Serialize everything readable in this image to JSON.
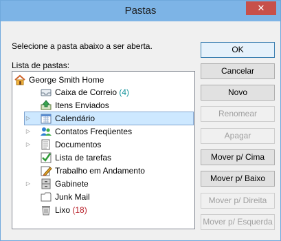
{
  "window": {
    "title": "Pastas",
    "close_glyph": "✕"
  },
  "prompt": "Selecione a pasta abaixo a ser aberta.",
  "list_label": "Lista de pastas:",
  "tree": {
    "root": {
      "label": "George Smith Home",
      "icon": "home-icon"
    },
    "items": [
      {
        "label": "Caixa de Correio",
        "count": "(4)",
        "icon": "inbox-icon",
        "expandable": false
      },
      {
        "label": "Itens Enviados",
        "count": "",
        "icon": "sent-items-icon",
        "expandable": false
      },
      {
        "label": "Calendário",
        "count": "",
        "icon": "calendar-icon",
        "expandable": true,
        "selected": true
      },
      {
        "label": "Contatos Freqüentes",
        "count": "",
        "icon": "contacts-icon",
        "expandable": true
      },
      {
        "label": "Documentos",
        "count": "",
        "icon": "documents-icon",
        "expandable": true
      },
      {
        "label": "Lista de tarefas",
        "count": "",
        "icon": "task-list-icon",
        "expandable": false
      },
      {
        "label": "Trabalho em Andamento",
        "count": "",
        "icon": "work-in-progress-icon",
        "expandable": false
      },
      {
        "label": "Gabinete",
        "count": "",
        "icon": "cabinet-icon",
        "expandable": true
      },
      {
        "label": "Junk Mail",
        "count": "",
        "icon": "folder-icon",
        "expandable": false
      },
      {
        "label": "Lixo",
        "count": "(18)",
        "icon": "trash-icon",
        "expandable": false
      }
    ]
  },
  "buttons": {
    "ok": "OK",
    "cancel": "Cancelar",
    "new": "Novo",
    "rename": "Renomear",
    "delete": "Apagar",
    "move_up": "Mover p/ Cima",
    "move_down": "Mover p/ Baixo",
    "move_right": "Mover p/ Direita",
    "move_left": "Mover p/ Esquerda"
  },
  "colors": {
    "titlebar": "#7db4e6",
    "close": "#c7504a",
    "selection": "#cde8ff",
    "count_inbox": "#13939a",
    "count_trash": "#b8202a"
  }
}
